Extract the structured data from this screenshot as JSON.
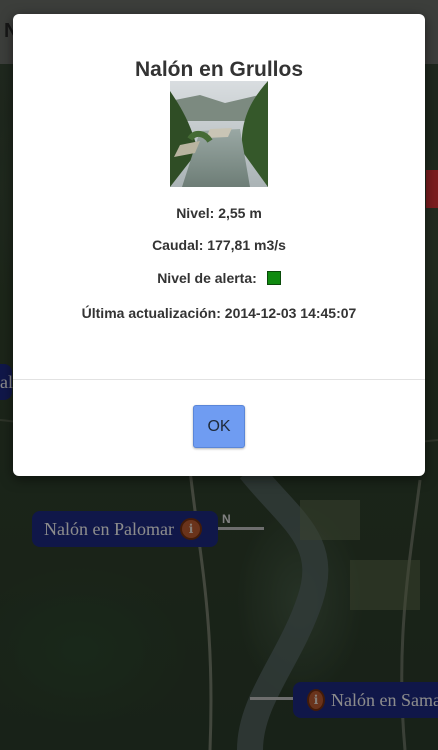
{
  "background": {
    "top_bar_glyph": "N"
  },
  "markers": [
    {
      "label": "Nalón en Palomar",
      "info_icon": "info-icon"
    },
    {
      "label": "Nalón en Sama",
      "info_icon": "info-icon"
    },
    {
      "label": "alo"
    }
  ],
  "modal": {
    "title": "Nalón en Grullos",
    "nivel": "Nivel: 2,55 m",
    "caudal": "Caudal: 177,81 m3/s",
    "alerta_label": "Nivel de alerta:",
    "alerta_color": "#108a10",
    "actualizacion": "Última actualización: 2014-12-03 14:45:07",
    "ok_label": "OK"
  }
}
